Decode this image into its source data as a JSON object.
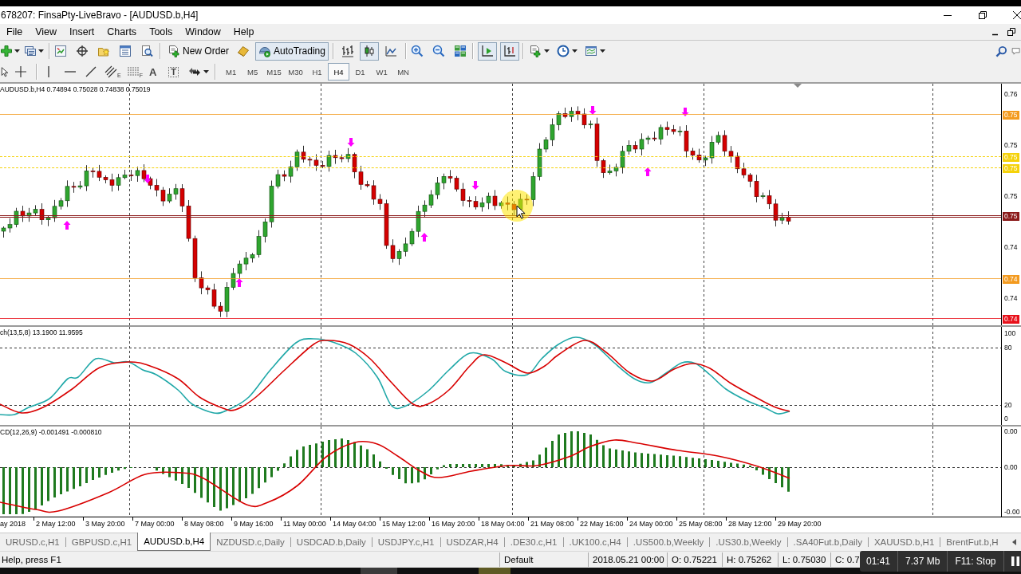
{
  "window": {
    "title": "678207: FinsaPty-LiveBravo - [AUDUSD.b,H4]"
  },
  "menu": [
    "File",
    "View",
    "Insert",
    "Charts",
    "Tools",
    "Window",
    "Help"
  ],
  "toolbar": {
    "new_order": "New Order",
    "auto_trading": {
      "label": "AutoTrading",
      "on": true
    },
    "chart_types": [
      {
        "kind": "bars",
        "selected": false
      },
      {
        "kind": "candles",
        "selected": true
      },
      {
        "kind": "line",
        "selected": false
      }
    ],
    "auto_scroll": {
      "on": true
    },
    "chart_shift": {
      "on": true
    }
  },
  "drawing_toolbar": {
    "channel_mark": "E",
    "fibonacci_mark": "F",
    "text_tool": "A",
    "label_tool": "T",
    "timeframes": [
      {
        "label": "M1",
        "selected": false
      },
      {
        "label": "M5",
        "selected": false
      },
      {
        "label": "M15",
        "selected": false
      },
      {
        "label": "M30",
        "selected": false
      },
      {
        "label": "H1",
        "selected": false
      },
      {
        "label": "H4",
        "selected": true
      },
      {
        "label": "D1",
        "selected": false
      },
      {
        "label": "W1",
        "selected": false
      },
      {
        "label": "MN",
        "selected": false
      }
    ]
  },
  "chart": {
    "symbol_info": "AUDUSD.b,H4 0.74894 0.75028 0.74838 0.75019",
    "price_scale": [
      "0.76",
      "0.75",
      "0.75",
      "0.74",
      "0.74"
    ],
    "price_lines": [
      {
        "label": "0.75",
        "color": "#f39a1e",
        "kind": "solid"
      },
      {
        "label": "0.75",
        "color": "#f5d20a",
        "kind": "dashed"
      },
      {
        "label": "0.75",
        "color": "#f5d20a",
        "kind": "dashed"
      },
      {
        "label": "0.75",
        "color": "#8b1a1a",
        "kind": "double"
      },
      {
        "label": "0.74",
        "color": "#f39a1e",
        "kind": "solid"
      },
      {
        "label": "0.74",
        "color": "#e8101a",
        "kind": "solid"
      }
    ],
    "stochastic": {
      "label": "ch(13,5,8) 13.1900 11.9595",
      "scale": [
        "100",
        "80",
        "20",
        "0"
      ]
    },
    "macd": {
      "label": "CD(12,26,9) -0.001491 -0.000810",
      "scale": [
        "0.00",
        "0.00",
        "-0.00"
      ]
    },
    "time_axis": [
      "ay 2018",
      "2 May 12:00",
      "3 May 20:00",
      "7 May 00:00",
      "8 May 08:00",
      "9 May 16:00",
      "11 May 00:00",
      "14 May 04:00",
      "15 May 12:00",
      "16 May 20:00",
      "18 May 04:00",
      "21 May 08:00",
      "22 May 16:00",
      "24 May 00:00",
      "25 May 08:00",
      "28 May 12:00",
      "29 May 20:00"
    ]
  },
  "tabs": [
    {
      "label": "URUSD.c,H1",
      "selected": false
    },
    {
      "label": "GBPUSD.c,H1",
      "selected": false
    },
    {
      "label": "AUDUSD.b,H4",
      "selected": true
    },
    {
      "label": "NZDUSD.c,Daily",
      "selected": false
    },
    {
      "label": "USDCAD.b,Daily",
      "selected": false
    },
    {
      "label": "USDJPY.c,H1",
      "selected": false
    },
    {
      "label": "USDZAR,H4",
      "selected": false
    },
    {
      "label": ".DE30.c,H1",
      "selected": false
    },
    {
      "label": ".UK100.c,H4",
      "selected": false
    },
    {
      "label": ".US500.b,Weekly",
      "selected": false
    },
    {
      "label": ".US30.b,Weekly",
      "selected": false
    },
    {
      "label": ".SA40Fut.b,Daily",
      "selected": false
    },
    {
      "label": "XAUUSD.b,H1",
      "selected": false
    },
    {
      "label": "BrentFut.b,H",
      "selected": false
    }
  ],
  "status_bar": {
    "help": "Help, press F1",
    "profile": "Default",
    "time": "2018.05.21 00:00",
    "open": "O: 0.75221",
    "high": "H: 0.75262",
    "low": "L: 0.75030",
    "close": "C: 0.7"
  },
  "recorder": {
    "elapsed": "01:41",
    "size": "7.37 Mb",
    "hint": "F11: Stop"
  }
}
